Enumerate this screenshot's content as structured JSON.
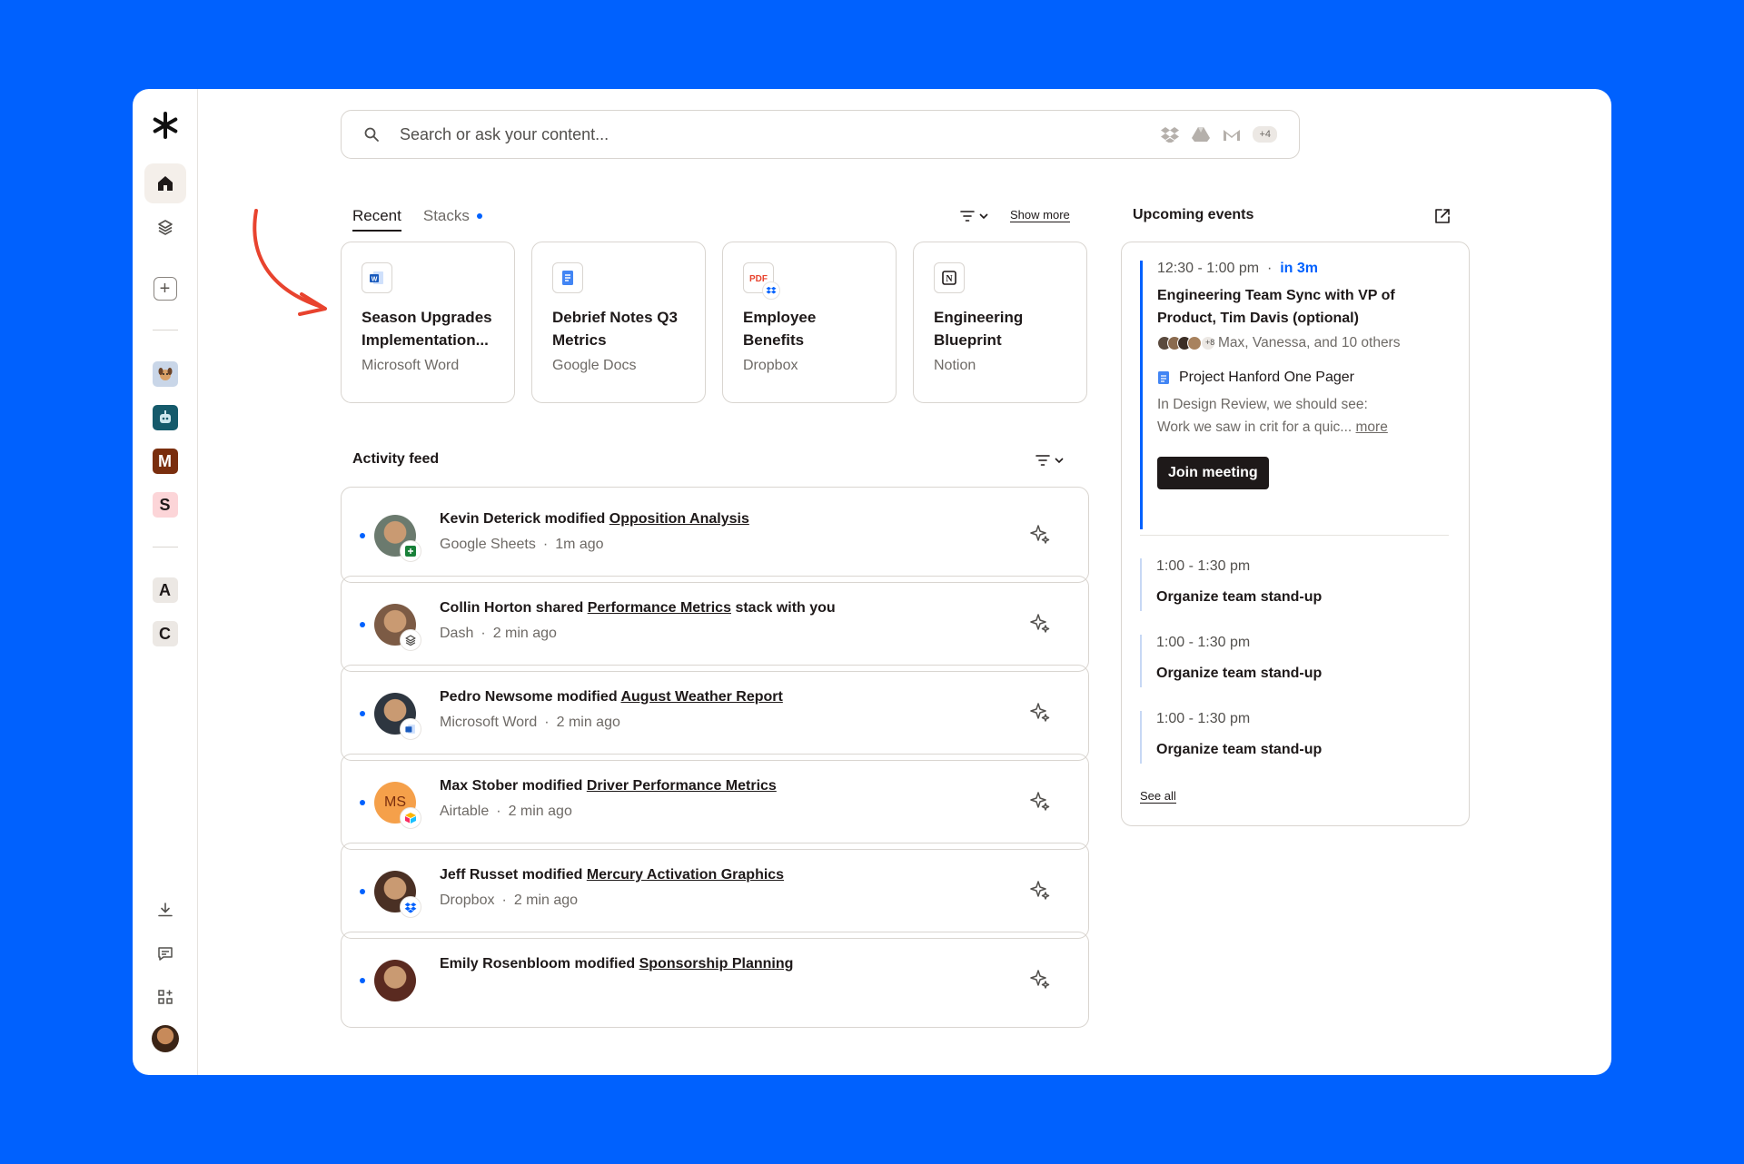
{
  "search": {
    "placeholder": "Search or ask your content...",
    "connectors_more": "+4"
  },
  "sidebar": {
    "workspaces": [
      {
        "letter": "M",
        "bg": "#7a2e0e",
        "fg": "#ffffff"
      },
      {
        "letter": "S",
        "bg": "#fcd5d8",
        "fg": "#1e1919"
      },
      {
        "letter": "A",
        "bg": "#ece8e4",
        "fg": "#1e1919"
      },
      {
        "letter": "C",
        "bg": "#ece8e4",
        "fg": "#1e1919"
      }
    ]
  },
  "tabs": {
    "recent": "Recent",
    "stacks": "Stacks",
    "show_more": "Show more"
  },
  "recent": [
    {
      "title": "Season Upgrades Implementation...",
      "source": "Microsoft Word"
    },
    {
      "title": "Debrief Notes Q3 Metrics",
      "source": "Google Docs"
    },
    {
      "title": "Employee Benefits",
      "source": "Dropbox"
    },
    {
      "title": "Engineering Blueprint",
      "source": "Notion"
    }
  ],
  "activity": {
    "title": "Activity feed",
    "items": [
      {
        "person": "Kevin Deterick",
        "verb": "modified",
        "doc": "Opposition Analysis",
        "suffix": "",
        "app": "Google Sheets",
        "time": "1m ago",
        "avatar_color": "#6b7a6e",
        "initials": ""
      },
      {
        "person": "Collin Horton",
        "verb": "shared",
        "doc": "Performance Metrics",
        "suffix": "stack with you",
        "app": "Dash",
        "time": "2 min ago",
        "avatar_color": "#7c5b45",
        "initials": ""
      },
      {
        "person": "Pedro Newsome",
        "verb": "modified",
        "doc": "August Weather Report",
        "suffix": "",
        "app": "Microsoft Word",
        "time": "2 min ago",
        "avatar_color": "#2e3640",
        "initials": ""
      },
      {
        "person": "Max Stober",
        "verb": "modified",
        "doc": "Driver Performance Metrics",
        "suffix": "",
        "app": "Airtable",
        "time": "2 min ago",
        "avatar_color": "#f5a04a",
        "initials": "MS"
      },
      {
        "person": "Jeff Russet",
        "verb": "modified",
        "doc": "Mercury Activation Graphics",
        "suffix": "",
        "app": "Dropbox",
        "time": "2 min ago",
        "avatar_color": "#4a3024",
        "initials": ""
      },
      {
        "person": "Emily Rosenbloom",
        "verb": "modified",
        "doc": "Sponsorship Planning",
        "suffix": "",
        "app": "",
        "time": "",
        "avatar_color": "#5a2a20",
        "initials": ""
      }
    ]
  },
  "events": {
    "title": "Upcoming events",
    "main": {
      "time": "12:30 - 1:00 pm",
      "soon": "in 3m",
      "title": "Engineering Team Sync with VP of Product, Tim Davis (optional)",
      "attendees_more": "+8",
      "attendees": "Max, Vanessa, and 10 others",
      "doc": "Project Hanford One Pager",
      "desc1": "In Design Review, we should see:",
      "desc2": "Work we saw in crit for a quic...",
      "more": "more",
      "join": "Join meeting"
    },
    "others": [
      {
        "time": "1:00 - 1:30 pm",
        "title": "Organize team stand-up"
      },
      {
        "time": "1:00 - 1:30 pm",
        "title": "Organize team stand-up"
      },
      {
        "time": "1:00 - 1:30 pm",
        "title": "Organize team stand-up"
      }
    ],
    "see_all": "See all"
  }
}
